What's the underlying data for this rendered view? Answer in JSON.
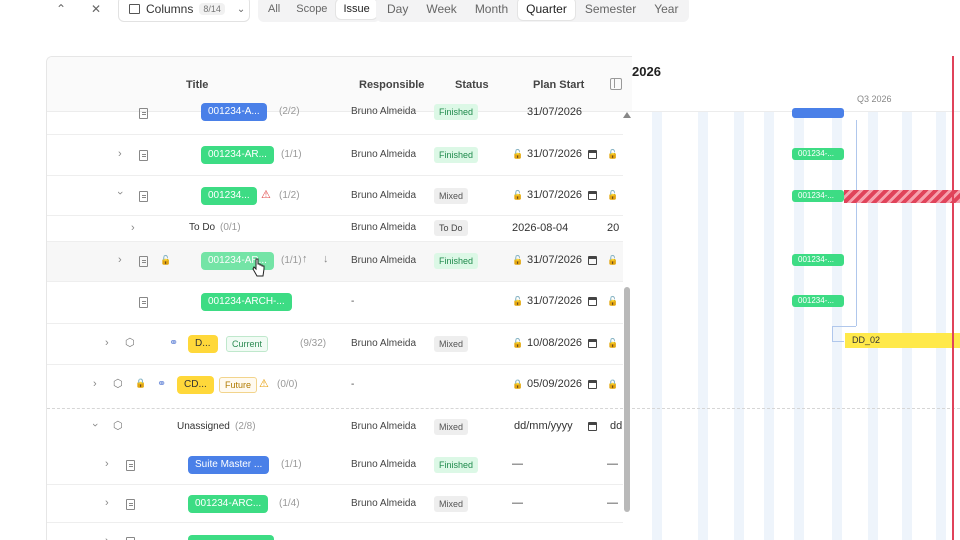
{
  "toolbar": {
    "columns_label": "Columns",
    "columns_badge": "8/14",
    "filter_tabs": [
      "All",
      "Scope",
      "Issue"
    ],
    "active_filter": "Issue",
    "zoom_tabs": [
      "Day",
      "Week",
      "Month",
      "Quarter",
      "Semester",
      "Year"
    ],
    "active_zoom": "Quarter"
  },
  "table": {
    "headers": {
      "title": "Title",
      "responsible": "Responsible",
      "status": "Status",
      "plan_start": "Plan Start"
    },
    "rows": [
      {
        "title": "001234-A...",
        "count": "(2/2)",
        "responsible": "Bruno Almeida",
        "status": "Finished",
        "date": "31/07/2026"
      },
      {
        "title": "001234-AR...",
        "count": "(1/1)",
        "responsible": "Bruno Almeida",
        "status": "Finished",
        "date": "31/07/2026"
      },
      {
        "title": "001234...",
        "count": "(1/2)",
        "responsible": "Bruno Almeida",
        "status": "Mixed",
        "date": "31/07/2026"
      },
      {
        "title": "To Do",
        "count": "(0/1)",
        "responsible": "Bruno Almeida",
        "status": "To Do",
        "date": "2026-08-04",
        "date2": "20"
      },
      {
        "title": "001234-AR...",
        "count": "(1/1)",
        "responsible": "Bruno Almeida",
        "status": "Finished",
        "date": "31/07/2026"
      },
      {
        "title": "001234-ARCH-...",
        "responsible": "-",
        "date": "31/07/2026"
      },
      {
        "title": "D...",
        "tag": "Current",
        "count": "(9/32)",
        "responsible": "Bruno Almeida",
        "status": "Mixed",
        "date": "10/08/2026"
      },
      {
        "title": "CD...",
        "tag": "Future",
        "count": "(0/0)",
        "responsible": "-",
        "date": "05/09/2026"
      },
      {
        "title": "Unassigned",
        "count": "(2/8)",
        "responsible": "Bruno Almeida",
        "status": "Mixed",
        "date": "dd/mm/yyyy",
        "date2": "dd"
      },
      {
        "title": "Suite Master ...",
        "count": "(1/1)",
        "responsible": "Bruno Almeida",
        "status": "Finished",
        "date": "—",
        "date2": "—"
      },
      {
        "title": "001234-ARC...",
        "count": "(1/4)",
        "responsible": "Bruno Almeida",
        "status": "Mixed",
        "date": "—",
        "date2": "—"
      }
    ]
  },
  "gantt": {
    "year_label": "2026",
    "quarter_label": "Q3 2026",
    "bars": [
      {
        "label": "001234-..."
      },
      {
        "label": "001234-..."
      },
      {
        "label": "001234-..."
      },
      {
        "label": "001234-..."
      },
      {
        "label": "001234-..."
      }
    ],
    "dd_label": "DD_02"
  },
  "colors": {
    "green": "#3ddc84",
    "blue": "#4a80e8",
    "yellow": "#ffd83a",
    "red": "#e0435a"
  }
}
